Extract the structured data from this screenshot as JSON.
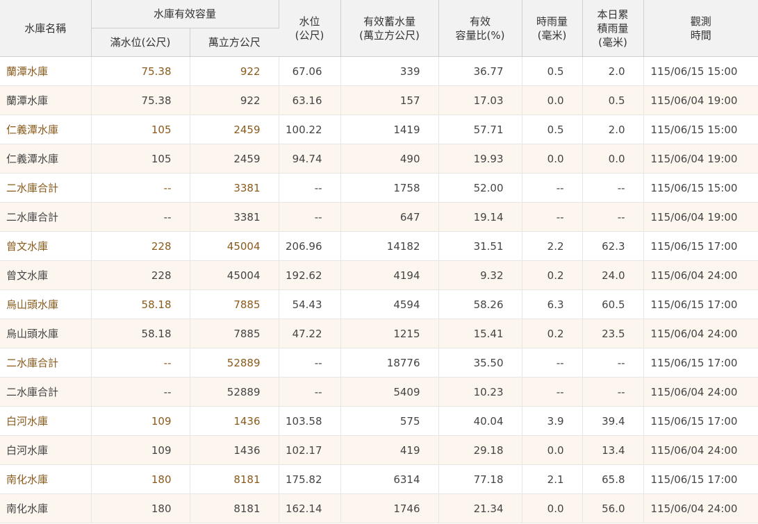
{
  "headers": {
    "name": "水庫名稱",
    "capacity_group": "水庫有效容量",
    "full_level": "滿水位(公尺)",
    "capacity_units": "萬立方公尺",
    "water_level": "水位\n(公尺)",
    "storage": "有效蓄水量\n(萬立方公尺)",
    "ratio": "有效\n容量比(%)",
    "hourly_rain": "時雨量\n(毫米)",
    "daily_rain": "本日累\n積雨量\n(毫米)",
    "obs_time": "觀測\n時間"
  },
  "rows": [
    {
      "name": "蘭潭水庫",
      "full_level": "75.38",
      "capacity": "922",
      "level": "67.06",
      "storage": "339",
      "ratio": "36.77",
      "hourly": "0.5",
      "daily": "2.0",
      "time": "115/06/15 15:00"
    },
    {
      "name": "蘭潭水庫",
      "full_level": "75.38",
      "capacity": "922",
      "level": "63.16",
      "storage": "157",
      "ratio": "17.03",
      "hourly": "0.0",
      "daily": "0.5",
      "time": "115/06/04 19:00"
    },
    {
      "name": "仁義潭水庫",
      "full_level": "105",
      "capacity": "2459",
      "level": "100.22",
      "storage": "1419",
      "ratio": "57.71",
      "hourly": "0.5",
      "daily": "2.0",
      "time": "115/06/15 15:00"
    },
    {
      "name": "仁義潭水庫",
      "full_level": "105",
      "capacity": "2459",
      "level": "94.74",
      "storage": "490",
      "ratio": "19.93",
      "hourly": "0.0",
      "daily": "0.0",
      "time": "115/06/04 19:00"
    },
    {
      "name": "二水庫合計",
      "full_level": "--",
      "capacity": "3381",
      "level": "--",
      "storage": "1758",
      "ratio": "52.00",
      "hourly": "--",
      "daily": "--",
      "time": "115/06/15 15:00"
    },
    {
      "name": "二水庫合計",
      "full_level": "--",
      "capacity": "3381",
      "level": "--",
      "storage": "647",
      "ratio": "19.14",
      "hourly": "--",
      "daily": "--",
      "time": "115/06/04 19:00"
    },
    {
      "name": "曾文水庫",
      "full_level": "228",
      "capacity": "45004",
      "level": "206.96",
      "storage": "14182",
      "ratio": "31.51",
      "hourly": "2.2",
      "daily": "62.3",
      "time": "115/06/15 17:00"
    },
    {
      "name": "曾文水庫",
      "full_level": "228",
      "capacity": "45004",
      "level": "192.62",
      "storage": "4194",
      "ratio": "9.32",
      "hourly": "0.2",
      "daily": "24.0",
      "time": "115/06/04 24:00"
    },
    {
      "name": "烏山頭水庫",
      "full_level": "58.18",
      "capacity": "7885",
      "level": "54.43",
      "storage": "4594",
      "ratio": "58.26",
      "hourly": "6.3",
      "daily": "60.5",
      "time": "115/06/15 17:00"
    },
    {
      "name": "烏山頭水庫",
      "full_level": "58.18",
      "capacity": "7885",
      "level": "47.22",
      "storage": "1215",
      "ratio": "15.41",
      "hourly": "0.2",
      "daily": "23.5",
      "time": "115/06/04 24:00"
    },
    {
      "name": "二水庫合計",
      "full_level": "--",
      "capacity": "52889",
      "level": "--",
      "storage": "18776",
      "ratio": "35.50",
      "hourly": "--",
      "daily": "--",
      "time": "115/06/15 17:00"
    },
    {
      "name": "二水庫合計",
      "full_level": "--",
      "capacity": "52889",
      "level": "--",
      "storage": "5409",
      "ratio": "10.23",
      "hourly": "--",
      "daily": "--",
      "time": "115/06/04 24:00"
    },
    {
      "name": "白河水庫",
      "full_level": "109",
      "capacity": "1436",
      "level": "103.58",
      "storage": "575",
      "ratio": "40.04",
      "hourly": "3.9",
      "daily": "39.4",
      "time": "115/06/15 17:00"
    },
    {
      "name": "白河水庫",
      "full_level": "109",
      "capacity": "1436",
      "level": "102.17",
      "storage": "419",
      "ratio": "29.18",
      "hourly": "0.0",
      "daily": "13.4",
      "time": "115/06/04 24:00"
    },
    {
      "name": "南化水庫",
      "full_level": "180",
      "capacity": "8181",
      "level": "175.82",
      "storage": "6314",
      "ratio": "77.18",
      "hourly": "2.1",
      "daily": "65.8",
      "time": "115/06/15 17:00"
    },
    {
      "name": "南化水庫",
      "full_level": "180",
      "capacity": "8181",
      "level": "162.14",
      "storage": "1746",
      "ratio": "21.34",
      "hourly": "0.0",
      "daily": "56.0",
      "time": "115/06/04 24:00"
    }
  ]
}
